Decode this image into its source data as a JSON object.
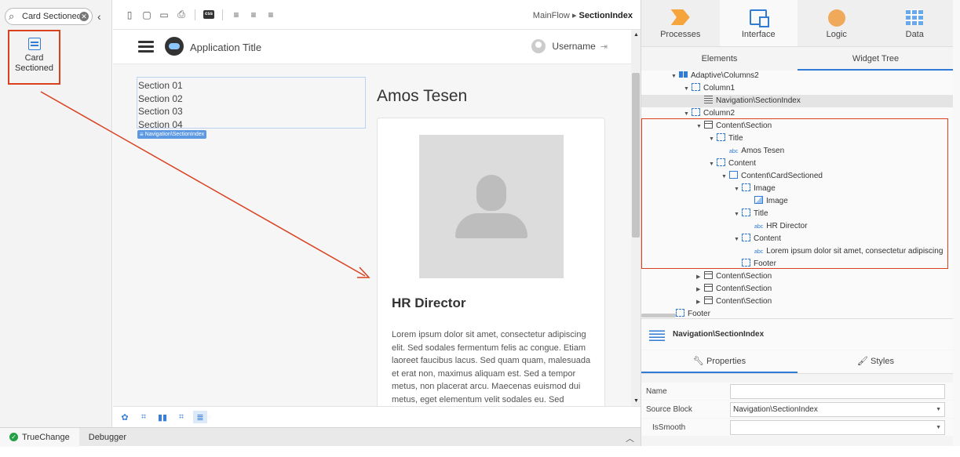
{
  "left_panel": {
    "search_value": "Card Sectioned",
    "widget_label_line1": "Card",
    "widget_label_line2": "Sectioned"
  },
  "toolbar": {
    "css_label": "css",
    "breadcrumb_flow": "MainFlow",
    "breadcrumb_sep": "▸",
    "breadcrumb_screen": "SectionIndex"
  },
  "canvas": {
    "app_title": "Application Title",
    "username": "Username",
    "section_index": [
      "Section 01",
      "Section 02",
      "Section 03",
      "Section 04"
    ],
    "section_index_tag": "Navigation\\SectionIndex",
    "main_title": "Amos Tesen",
    "card_title": "HR Director",
    "card_text": "Lorem ipsum dolor sit amet, consectetur adipiscing elit. Sed sodales fermentum felis ac congue. Etiam laoreet faucibus lacus. Sed quam quam, malesuada et erat non, maximus aliquam est. Sed a tempor metus, non placerat arcu. Maecenas euismod dui metus, eget elementum velit sodales eu. Sed"
  },
  "statusbar": {
    "truechange": "TrueChange",
    "debugger": "Debugger"
  },
  "right_panel": {
    "layer_tabs": [
      "Processes",
      "Interface",
      "Logic",
      "Data"
    ],
    "sub_tabs": [
      "Elements",
      "Widget Tree"
    ],
    "tree": [
      {
        "label": "Adaptive\\Columns2",
        "icon": "cols-icon",
        "tri": "▼"
      },
      {
        "label": "Column1",
        "icon": "placeholder-icon",
        "tri": "▼"
      },
      {
        "label": "Navigation\\SectionIndex",
        "icon": "list-icon",
        "tri": ""
      },
      {
        "label": "Column2",
        "icon": "placeholder-icon",
        "tri": "▼"
      },
      {
        "label": "Content\\Section",
        "icon": "section-icon",
        "tri": "▼"
      },
      {
        "label": "Title",
        "icon": "placeholder-icon",
        "tri": "▼"
      },
      {
        "label": "Amos Tesen",
        "icon": "abc-icon",
        "tri": ""
      },
      {
        "label": "Content",
        "icon": "placeholder-icon",
        "tri": "▼"
      },
      {
        "label": "Content\\CardSectioned",
        "icon": "card-icon",
        "tri": "▼"
      },
      {
        "label": "Image",
        "icon": "placeholder-icon",
        "tri": "▼"
      },
      {
        "label": "Image",
        "icon": "image-icon",
        "tri": ""
      },
      {
        "label": "Title",
        "icon": "placeholder-icon",
        "tri": "▼"
      },
      {
        "label": "HR Director",
        "icon": "abc-icon",
        "tri": ""
      },
      {
        "label": "Content",
        "icon": "placeholder-icon",
        "tri": "▼"
      },
      {
        "label": "Lorem ipsum dolor sit amet, consectetur adipiscing",
        "icon": "abc-icon",
        "tri": ""
      },
      {
        "label": "Footer",
        "icon": "placeholder-icon",
        "tri": ""
      },
      {
        "label": "Content\\Section",
        "icon": "section-icon",
        "tri": "▶"
      },
      {
        "label": "Content\\Section",
        "icon": "section-icon",
        "tri": "▶"
      },
      {
        "label": "Content\\Section",
        "icon": "section-icon",
        "tri": "▶"
      },
      {
        "label": "Footer",
        "icon": "placeholder-icon",
        "tri": ""
      }
    ],
    "selected_widget": "Navigation\\SectionIndex",
    "props_tabs": [
      "Properties",
      "Styles"
    ],
    "props": [
      {
        "label": "Name",
        "value": ""
      },
      {
        "label": "Source Block",
        "value": "Navigation\\SectionIndex"
      },
      {
        "label": "IsSmooth",
        "value": ""
      }
    ]
  },
  "colors": {
    "accent": "#2f7bd6",
    "highlight": "#d9401e",
    "truechange_ok": "#23a045"
  }
}
